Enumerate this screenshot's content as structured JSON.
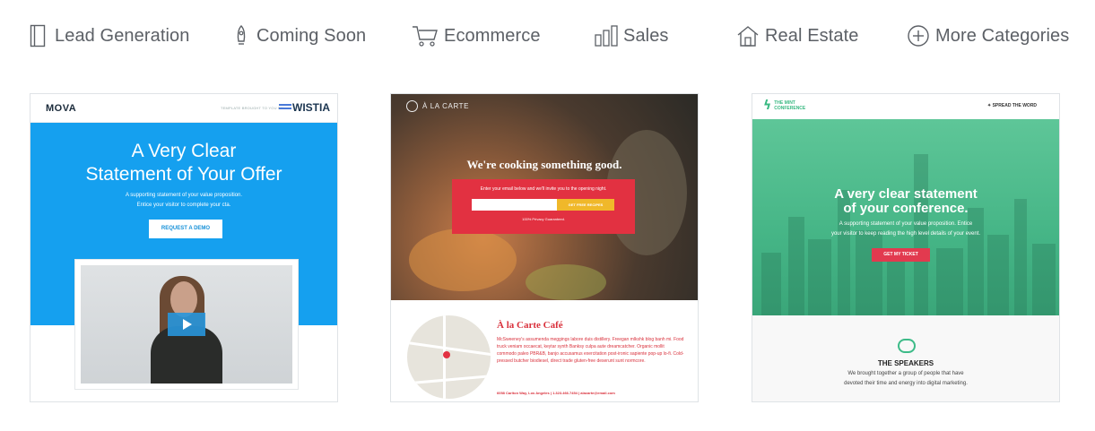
{
  "categories": [
    {
      "label": "Lead Generation",
      "icon": "book-icon"
    },
    {
      "label": "Coming Soon",
      "icon": "rocket-icon"
    },
    {
      "label": "Ecommerce",
      "icon": "cart-icon"
    },
    {
      "label": "Sales",
      "icon": "bar-chart-icon"
    },
    {
      "label": "Real Estate",
      "icon": "house-icon"
    },
    {
      "label": "More Categories",
      "icon": "plus-circle-icon"
    }
  ],
  "templates": {
    "mova": {
      "logo": "MOVA",
      "byline": "TEMPLATE BROUGHT TO YOU BY",
      "partner": "WISTIA",
      "headline_line1": "A Very Clear",
      "headline_line2": "Statement of Your Offer",
      "sub_line1": "A supporting statement of your value proposition.",
      "sub_line2": "Entice your visitor to complete your cta.",
      "cta": "REQUEST A DEMO"
    },
    "alacarte": {
      "logo": "À LA CARTE",
      "headline": "We're cooking something good.",
      "box_text": "Enter your email below and we'll invite you to the opening night.",
      "cta": "GET FREE RECIPES",
      "guarantee": "100% Privacy Guaranteed.",
      "title": "À la Carte Café",
      "body": "McSweeney's assumenda meggings labore duis distillery. Freegan mlkshk blog banh mi. Food truck veniam occaecat, keytar synth Banksy culpa aute dreamcatcher. Organic mollit commodo paleo PBR&B, banjo accusamus exercitation post-ironic sapiente pop-up lo-fi. Cold-pressed butcher biodiesel, direct trade gluten-free deserunt sunt normcore.",
      "address": "6058 Carlton Way, Los Angeles  |  1.323.466.7454  |  alacarte@email.com"
    },
    "mint": {
      "logo_line1": "THE MINT",
      "logo_line2": "CONFERENCE",
      "share": "SPREAD THE WORD",
      "headline_line1": "A very clear statement",
      "headline_line2": "of your conference.",
      "sub_line1": "A supporting statement of your value proposition. Entice",
      "sub_line2": "your visitor to keep reading the high level details of your event.",
      "cta": "GET MY TICKET",
      "speakers_title": "THE SPEAKERS",
      "speakers_line1": "We brought together a group of people that have",
      "speakers_line2": "devoted their time and energy into digital marketing."
    }
  },
  "colors": {
    "mova_blue": "#15a0ef",
    "alacarte_red": "#e23141",
    "mint_green": "#45b586"
  }
}
